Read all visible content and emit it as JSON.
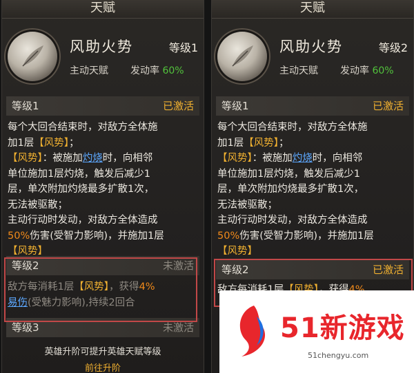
{
  "panels": [
    {
      "title": "天赋",
      "skill_name": "风助火势",
      "skill_level": "等级1",
      "skill_type": "主动天赋",
      "rate_label": "发动率",
      "rate_value": "60%",
      "level1": {
        "name": "等级1",
        "status": "已激活"
      },
      "desc": {
        "l1": "每个大回合结束时，对敌方全体施",
        "l2a": "加1层",
        "l2b": "【风势】",
        "l2c": "；",
        "l3a": "【风势】",
        "l3b": "：被施加",
        "l3c": "灼烧",
        "l3d": "时，向相邻",
        "l4": "单位施加1层灼烧，触发后减少1",
        "l5": "层，单次附加灼烧最多扩散1次，",
        "l6": "无法被驱散；",
        "l7": "主动行动时发动，对敌方全体造成",
        "l8a": "50%",
        "l8b": "伤害(受智力影响)，并施加1层",
        "l9": "【风势】"
      },
      "level2": {
        "name": "等级2",
        "status": "未激活"
      },
      "desc2": {
        "l1a": "敌方每消耗1层",
        "l1b": "【风势】",
        "l1c": "，获得",
        "l1d": "4%",
        "l2a": "易伤",
        "l2b": "(受魅力影响),持续2回合"
      },
      "level3": {
        "name": "等级3",
        "status": "未激活"
      },
      "footer": "英雄升阶可提升英雄天赋等级",
      "promote": "前往升阶"
    },
    {
      "title": "天赋",
      "skill_name": "风助火势",
      "skill_level": "等级2",
      "skill_type": "主动天赋",
      "rate_label": "发动率",
      "rate_value": "60%",
      "level1": {
        "name": "等级1",
        "status": "已激活"
      },
      "desc": {
        "l1": "每个大回合结束时，对敌方全体施",
        "l2a": "加1层",
        "l2b": "【风势】",
        "l2c": "；",
        "l3a": "【风势】",
        "l3b": "：被施加",
        "l3c": "灼烧",
        "l3d": "时，向相邻",
        "l4": "单位施加1层灼烧，触发后减少1",
        "l5": "层，单次附加灼烧最多扩散1次，",
        "l6": "无法被驱散；",
        "l7": "主动行动时发动，对敌方全体造成",
        "l8a": "50%",
        "l8b": "伤害(受智力影响)，并施加1层",
        "l9": "【风势】"
      },
      "level2": {
        "name": "等级2",
        "status": "已激活"
      },
      "desc2": {
        "l1a": "敌方每消耗1层",
        "l1b": "【风势】",
        "l1c": "，获得",
        "l1d": "4%"
      }
    }
  ],
  "watermark": {
    "brand": "51新游戏",
    "url": "51chengyu.com"
  },
  "colors": {
    "active": "#f0b030",
    "green": "#52c23c",
    "highlight": "#c24848",
    "brand": "#e8262c"
  }
}
